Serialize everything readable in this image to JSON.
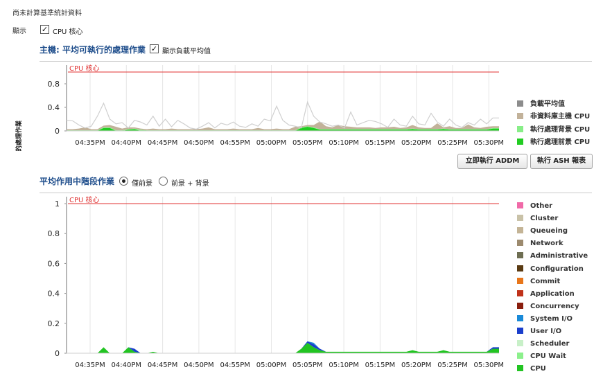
{
  "notice": "尚未計算基準統計資料",
  "show": {
    "label": "顯示",
    "cpu_cores_checked": true,
    "cpu_cores_label": "CPU 核心"
  },
  "host": {
    "title": "主機: 平均可執行的處理作業",
    "show_load_avg_checked": true,
    "show_load_avg_label": "顯示負載平均值",
    "ylabel": "可執行的處理作業",
    "cpu_cores_line_label": "CPU 核心",
    "legend": [
      {
        "label": "負載平均值",
        "color": "#8c8c8c"
      },
      {
        "label": "非資料庫主機 CPU",
        "color": "#c2b29a"
      },
      {
        "label": "執行處理背景 CPU",
        "color": "#88ee88"
      },
      {
        "label": "執行處理前景 CPU",
        "color": "#22cc22"
      }
    ]
  },
  "buttons": {
    "addm": "立即執行 ADDM",
    "ash": "執行 ASH 報表"
  },
  "aas": {
    "title": "平均作用中階段作業",
    "radio_foreground_label": "僅前景",
    "radio_fg_bg_label": "前景 + 背景",
    "selected": "僅前景",
    "cpu_cores_line_label": "CPU 核心",
    "legend": [
      {
        "label": "Other",
        "color": "#f06aa8"
      },
      {
        "label": "Cluster",
        "color": "#c9c2a8"
      },
      {
        "label": "Queueing",
        "color": "#c4b496"
      },
      {
        "label": "Network",
        "color": "#9c8a6e"
      },
      {
        "label": "Administrative",
        "color": "#6e6e52"
      },
      {
        "label": "Configuration",
        "color": "#5a3a12"
      },
      {
        "label": "Commit",
        "color": "#e8761a"
      },
      {
        "label": "Application",
        "color": "#c0321a"
      },
      {
        "label": "Concurrency",
        "color": "#8a1e0e"
      },
      {
        "label": "System I/O",
        "color": "#1a8ad8"
      },
      {
        "label": "User I/O",
        "color": "#1a3ecc"
      },
      {
        "label": "Scheduler",
        "color": "#c8f0c8"
      },
      {
        "label": "CPU Wait",
        "color": "#8cf08c"
      },
      {
        "label": "CPU",
        "color": "#22c422"
      }
    ]
  },
  "chart_data": [
    {
      "type": "area",
      "title": "主機: 平均可執行的處理作業",
      "ylabel": "可執行的處理作業",
      "ylim": [
        0,
        1.0
      ],
      "yticks": [
        "0",
        "0.4",
        "0.8"
      ],
      "xticks": [
        "04:35PM",
        "04:40PM",
        "04:45PM",
        "04:50PM",
        "04:55PM",
        "05:00PM",
        "05:05PM",
        "05:10PM",
        "05:15PM",
        "05:20PM",
        "05:25PM",
        "05:30PM"
      ],
      "reference_line": {
        "label": "CPU 核心",
        "value": 1.0,
        "color": "#e03030"
      },
      "series": [
        {
          "name": "負載平均值",
          "values": [
            0.18,
            0.17,
            0.1,
            0.05,
            0.08,
            0.25,
            0.47,
            0.2,
            0.12,
            0.14,
            0.05,
            0.18,
            0.15,
            0.1,
            0.25,
            0.08,
            0.2,
            0.07,
            0.18,
            0.12,
            0.05,
            0.03,
            0.08,
            0.14,
            0.05,
            0.13,
            0.1,
            0.15,
            0.08,
            0.06,
            0.12,
            0.08,
            0.2,
            0.17,
            0.42,
            0.18,
            0.1,
            0.08,
            0.05,
            0.49,
            0.25,
            0.15,
            0.12,
            0.08,
            0.1,
            0.05,
            0.32,
            0.1,
            0.14,
            0.18,
            0.16,
            0.12,
            0.06,
            0.2,
            0.1,
            0.08,
            0.25,
            0.12,
            0.1,
            0.3,
            0.15,
            0.08,
            0.2,
            0.1,
            0.06,
            0.14,
            0.1,
            0.2,
            0.12,
            0.22,
            0.22
          ]
        },
        {
          "name": "非資料庫主機 CPU",
          "values": [
            0.02,
            0.02,
            0.03,
            0.05,
            0.02,
            0.02,
            0.03,
            0.04,
            0.06,
            0.03,
            0.03,
            0.02,
            0.02,
            0.02,
            0.03,
            0.02,
            0.02,
            0.03,
            0.02,
            0.02,
            0.02,
            0.02,
            0.03,
            0.05,
            0.02,
            0.02,
            0.02,
            0.03,
            0.02,
            0.02,
            0.02,
            0.04,
            0.02,
            0.02,
            0.03,
            0.02,
            0.02,
            0.06,
            0.02,
            0.02,
            0.04,
            0.13,
            0.05,
            0.03,
            0.07,
            0.05,
            0.04,
            0.03,
            0.03,
            0.03,
            0.02,
            0.03,
            0.03,
            0.04,
            0.02,
            0.03,
            0.06,
            0.03,
            0.02,
            0.02,
            0.1,
            0.02,
            0.05,
            0.02,
            0.02,
            0.08,
            0.03,
            0.02,
            0.04,
            0.03,
            0.03
          ]
        },
        {
          "name": "執行處理背景 CPU",
          "values": [
            0.01,
            0.01,
            0.01,
            0.01,
            0.01,
            0.01,
            0.01,
            0.01,
            0.01,
            0.01,
            0.01,
            0.01,
            0.02,
            0.01,
            0.01,
            0.01,
            0.01,
            0.01,
            0.01,
            0.01,
            0.01,
            0.01,
            0.01,
            0.01,
            0.01,
            0.01,
            0.01,
            0.01,
            0.01,
            0.01,
            0.01,
            0.01,
            0.01,
            0.01,
            0.01,
            0.01,
            0.01,
            0.01,
            0.01,
            0.01,
            0.01,
            0.01,
            0.01,
            0.01,
            0.01,
            0.01,
            0.01,
            0.01,
            0.01,
            0.01,
            0.01,
            0.01,
            0.01,
            0.01,
            0.01,
            0.01,
            0.01,
            0.01,
            0.01,
            0.01,
            0.01,
            0.01,
            0.01,
            0.01,
            0.01,
            0.01,
            0.01,
            0.01,
            0.01,
            0.01,
            0.01
          ]
        },
        {
          "name": "執行處理前景 CPU",
          "values": [
            0,
            0,
            0,
            0,
            0,
            0,
            0.05,
            0.05,
            0,
            0,
            0.02,
            0.03,
            0,
            0,
            0,
            0,
            0,
            0,
            0,
            0,
            0,
            0,
            0,
            0,
            0,
            0,
            0,
            0,
            0,
            0,
            0,
            0,
            0,
            0,
            0,
            0,
            0,
            0,
            0.05,
            0.07,
            0.05,
            0.02,
            0.02,
            0.02,
            0.02,
            0.02,
            0.02,
            0.02,
            0.02,
            0.02,
            0.02,
            0.02,
            0.02,
            0.02,
            0.02,
            0.02,
            0.03,
            0.02,
            0.02,
            0.02,
            0.02,
            0.03,
            0.02,
            0.02,
            0.02,
            0.02,
            0.02,
            0.02,
            0.02,
            0.04,
            0.04
          ]
        }
      ]
    },
    {
      "type": "area",
      "title": "平均作用中階段作業",
      "ylim": [
        0,
        1
      ],
      "yticks": [
        "0",
        "0.2",
        "0.4",
        "0.6",
        "0.8",
        "1"
      ],
      "xticks": [
        "04:35PM",
        "04:40PM",
        "04:45PM",
        "04:50PM",
        "04:55PM",
        "05:00PM",
        "05:05PM",
        "05:10PM",
        "05:15PM",
        "05:20PM",
        "05:25PM",
        "05:30PM"
      ],
      "reference_line": {
        "label": "CPU 核心",
        "value": 1.0,
        "color": "#e03030"
      },
      "series": [
        {
          "name": "CPU",
          "values": [
            0,
            0,
            0,
            0,
            0,
            0,
            0.04,
            0,
            0,
            0,
            0.04,
            0.01,
            0,
            0,
            0.01,
            0,
            0,
            0,
            0,
            0,
            0,
            0,
            0,
            0,
            0,
            0,
            0,
            0,
            0,
            0,
            0,
            0,
            0,
            0,
            0,
            0,
            0,
            0,
            0.03,
            0.07,
            0.04,
            0.02,
            0.01,
            0.01,
            0.01,
            0.01,
            0.01,
            0.01,
            0.01,
            0.01,
            0.01,
            0.01,
            0.01,
            0.01,
            0.01,
            0.01,
            0.02,
            0.01,
            0.01,
            0.01,
            0.01,
            0.02,
            0.01,
            0.01,
            0.01,
            0.01,
            0.01,
            0.01,
            0.01,
            0.03,
            0.03
          ]
        },
        {
          "name": "User I/O",
          "values": [
            0,
            0,
            0,
            0,
            0,
            0,
            0,
            0,
            0,
            0,
            0,
            0.02,
            0,
            0,
            0,
            0,
            0,
            0,
            0,
            0,
            0,
            0,
            0,
            0,
            0,
            0,
            0,
            0,
            0,
            0,
            0,
            0,
            0,
            0,
            0,
            0,
            0,
            0,
            0,
            0.01,
            0.02,
            0.01,
            0,
            0,
            0,
            0,
            0,
            0,
            0,
            0,
            0,
            0,
            0,
            0,
            0,
            0,
            0,
            0,
            0,
            0,
            0,
            0,
            0,
            0,
            0,
            0,
            0,
            0,
            0,
            0.01,
            0.01
          ]
        },
        {
          "name": "System I/O",
          "values": [
            0,
            0,
            0,
            0,
            0,
            0,
            0,
            0,
            0,
            0,
            0,
            0,
            0,
            0,
            0,
            0,
            0,
            0,
            0,
            0,
            0,
            0,
            0,
            0,
            0,
            0,
            0,
            0,
            0,
            0,
            0,
            0,
            0,
            0,
            0,
            0,
            0,
            0,
            0,
            0,
            0.01,
            0,
            0,
            0,
            0,
            0,
            0,
            0,
            0,
            0,
            0,
            0,
            0,
            0,
            0,
            0,
            0,
            0,
            0,
            0,
            0,
            0,
            0,
            0,
            0,
            0,
            0,
            0,
            0,
            0,
            0
          ]
        }
      ]
    }
  ]
}
